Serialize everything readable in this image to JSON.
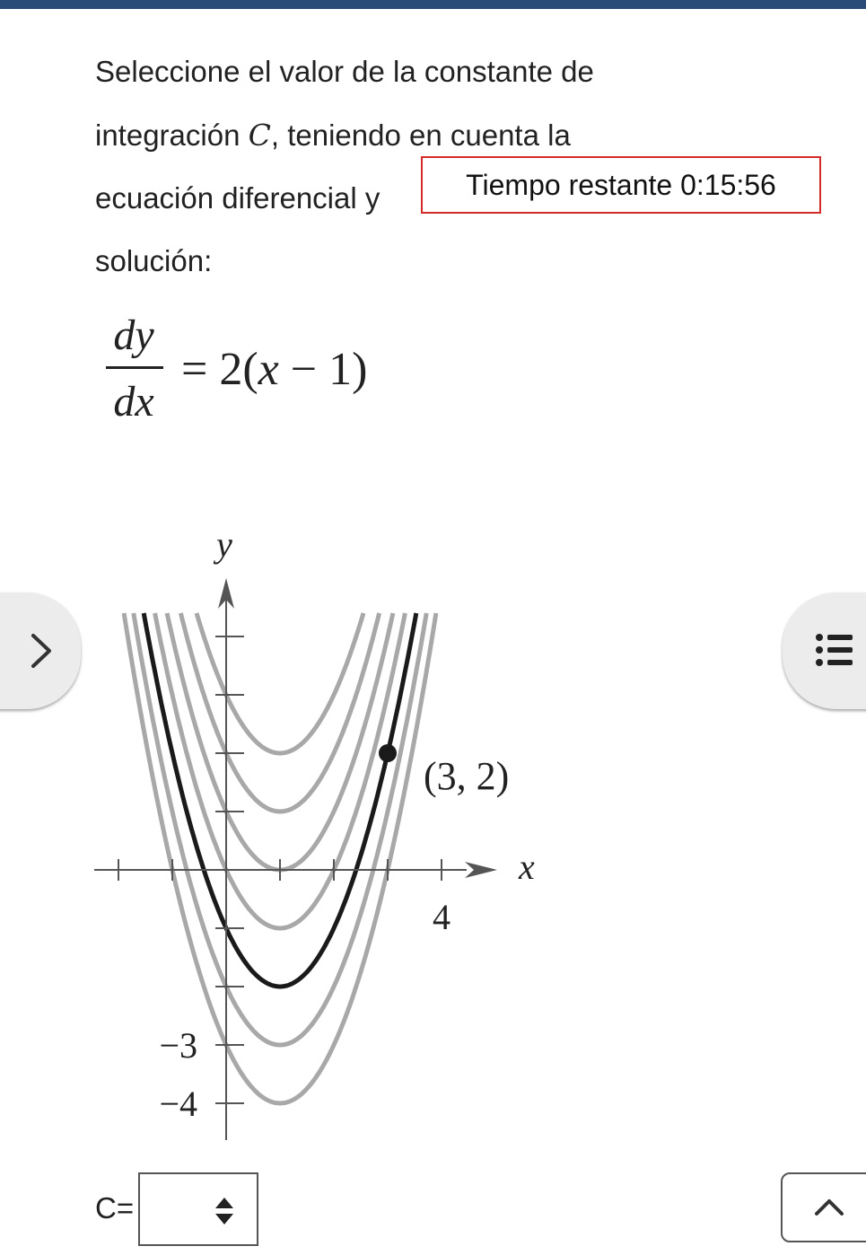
{
  "question": {
    "line1": "Seleccione el valor de la constante de",
    "line2_before": "integración ",
    "constant": "C",
    "line2_after": ", teniendo en cuenta la",
    "line3": "ecuación diferencial y",
    "line4": "solución:"
  },
  "timer": {
    "label": "Tiempo restante 0:15:56"
  },
  "equation": {
    "numerator": "dy",
    "denominator": "dx",
    "rhs_prefix": "= 2(",
    "rhs_var": "x",
    "rhs_suffix": " − 1)"
  },
  "chart_data": {
    "type": "line",
    "title": "",
    "xlabel": "x",
    "ylabel": "y",
    "family": "y = (x − 1)^2 + C",
    "highlighted_point": {
      "x": 3,
      "y": 2,
      "label": "(3, 2)"
    },
    "highlighted_curve": {
      "name": "",
      "C": -2
    },
    "series": [
      {
        "C": 2,
        "values_x": [
          -2,
          -1,
          0,
          1,
          2,
          3,
          4
        ],
        "values_y": [
          11,
          6,
          3,
          2,
          3,
          6,
          11
        ]
      },
      {
        "C": 1,
        "values_x": [
          -2,
          -1,
          0,
          1,
          2,
          3,
          4
        ],
        "values_y": [
          10,
          5,
          2,
          1,
          2,
          5,
          10
        ]
      },
      {
        "C": 0,
        "values_x": [
          -2,
          -1,
          0,
          1,
          2,
          3,
          4
        ],
        "values_y": [
          9,
          4,
          1,
          0,
          1,
          4,
          9
        ]
      },
      {
        "C": -1,
        "values_x": [
          -2,
          -1,
          0,
          1,
          2,
          3,
          4
        ],
        "values_y": [
          8,
          3,
          0,
          -1,
          0,
          3,
          8
        ]
      },
      {
        "C": -2,
        "values_x": [
          -2,
          -1,
          0,
          1,
          2,
          3,
          4
        ],
        "values_y": [
          7,
          2,
          -1,
          -2,
          -1,
          2,
          7
        ]
      },
      {
        "C": -3,
        "values_x": [
          -2,
          -1,
          0,
          1,
          2,
          3,
          4
        ],
        "values_y": [
          6,
          1,
          -2,
          -3,
          -2,
          1,
          6
        ]
      },
      {
        "C": -4,
        "values_x": [
          -2,
          -1,
          0,
          1,
          2,
          3,
          4
        ],
        "values_y": [
          5,
          0,
          -3,
          -4,
          -3,
          0,
          5
        ]
      }
    ],
    "xlim": [
      -2,
      4.8
    ],
    "ylim": [
      -4.5,
      4.5
    ],
    "x_tick_labels": [
      {
        "value": 4,
        "label": "4"
      }
    ],
    "y_tick_labels": [
      {
        "value": -3,
        "label": "−3"
      },
      {
        "value": -4,
        "label": "−4"
      }
    ],
    "colors": {
      "family": "#a8a8a8",
      "highlight": "#1a1a1a",
      "axes": "#555555"
    }
  },
  "answer": {
    "label": "C=",
    "selected_value": ""
  },
  "icons": {
    "left": "chevron-right-icon",
    "right": "list-icon",
    "select": "sort-arrows-icon",
    "scroll": "chevron-up-icon"
  }
}
